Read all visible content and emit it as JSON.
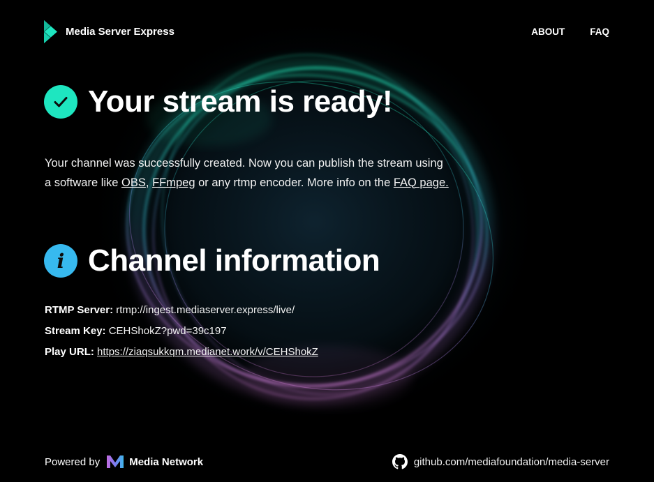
{
  "header": {
    "brand_name": "Media Server Express",
    "nav": [
      {
        "label": "ABOUT"
      },
      {
        "label": "FAQ"
      }
    ]
  },
  "ready": {
    "title": "Your stream is ready!",
    "text_1": "Your channel was successfully created. Now you can publish the stream using a software like ",
    "link_obs": "OBS",
    "text_2": ", ",
    "link_ffmpeg": "FFmpeg",
    "text_3": " or any rtmp encoder. More info on the ",
    "link_faq": "FAQ page.",
    "icon": "check-icon",
    "badge_color": "#1ee6c0"
  },
  "channel": {
    "title": "Channel information",
    "icon": "info-icon",
    "icon_glyph": "i",
    "badge_color": "#37b9ef",
    "rtmp_label": "RTMP Server:",
    "rtmp_value": "rtmp://ingest.mediaserver.express/live/",
    "key_label": "Stream Key:",
    "key_value": "CEHShokZ?pwd=39c197",
    "play_label": "Play URL:",
    "play_value": "https://ziaqsukkqm.medianet.work/v/CEHShokZ"
  },
  "footer": {
    "powered_by": "Powered by",
    "network_name": "Media Network",
    "github_text": "github.com/mediafoundation/media-server",
    "icon": "github-icon"
  },
  "colors": {
    "background": "#000000",
    "teal": "#1ee6c0",
    "blue": "#37b9ef",
    "violet": "#c77ee8"
  }
}
